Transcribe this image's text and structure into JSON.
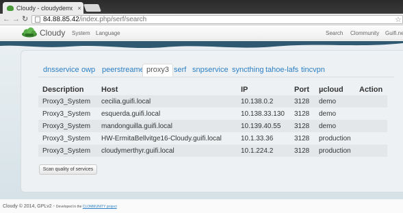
{
  "browser": {
    "tab_title": "Cloudy - cloudydemo",
    "tab_close": "×",
    "url_host": "84.88.85.42",
    "url_path": "/index.php/serf/search"
  },
  "header": {
    "brand": "Cloudy",
    "nav_system": "System",
    "nav_language": "Language",
    "nav_search": "Search",
    "nav_community": "Clommunity",
    "nav_guifi": "Guifi.net"
  },
  "tabs": [
    "dnsservice",
    "owp",
    "peerstreamer",
    "proxy3",
    "serf",
    "snpservice",
    "syncthing",
    "tahoe-lafs",
    "tincvpn"
  ],
  "active_tab": "proxy3",
  "table": {
    "headers": [
      "Description",
      "Host",
      "IP",
      "Port",
      "µcloud",
      "Action"
    ],
    "rows": [
      [
        "Proxy3_System",
        "cecilia.guifi.local",
        "10.138.0.2",
        "3128",
        "demo",
        ""
      ],
      [
        "Proxy3_System",
        "esquerda.guifi.local",
        "10.138.33.130",
        "3128",
        "demo",
        ""
      ],
      [
        "Proxy3_System",
        "mandonguilla.guifi.local",
        "10.139.40.55",
        "3128",
        "demo",
        ""
      ],
      [
        "Proxy3_System",
        "HW-ErmitaBellvitge16-Cloudy.guifi.local",
        "10.1.33.36",
        "3128",
        "production",
        ""
      ],
      [
        "Proxy3_System",
        "cloudymerthyr.guifi.local",
        "10.1.224.2",
        "3128",
        "production",
        ""
      ]
    ]
  },
  "scan_button": "Scan quality of services",
  "footer": {
    "copyright": "Cloudy © 2014, GPLv2 - ",
    "developed": "Developed in the ",
    "link": "CLOMMUNITY project"
  },
  "colors": {
    "link": "#2a7fc5",
    "brand_green": "#4a9a3a"
  }
}
